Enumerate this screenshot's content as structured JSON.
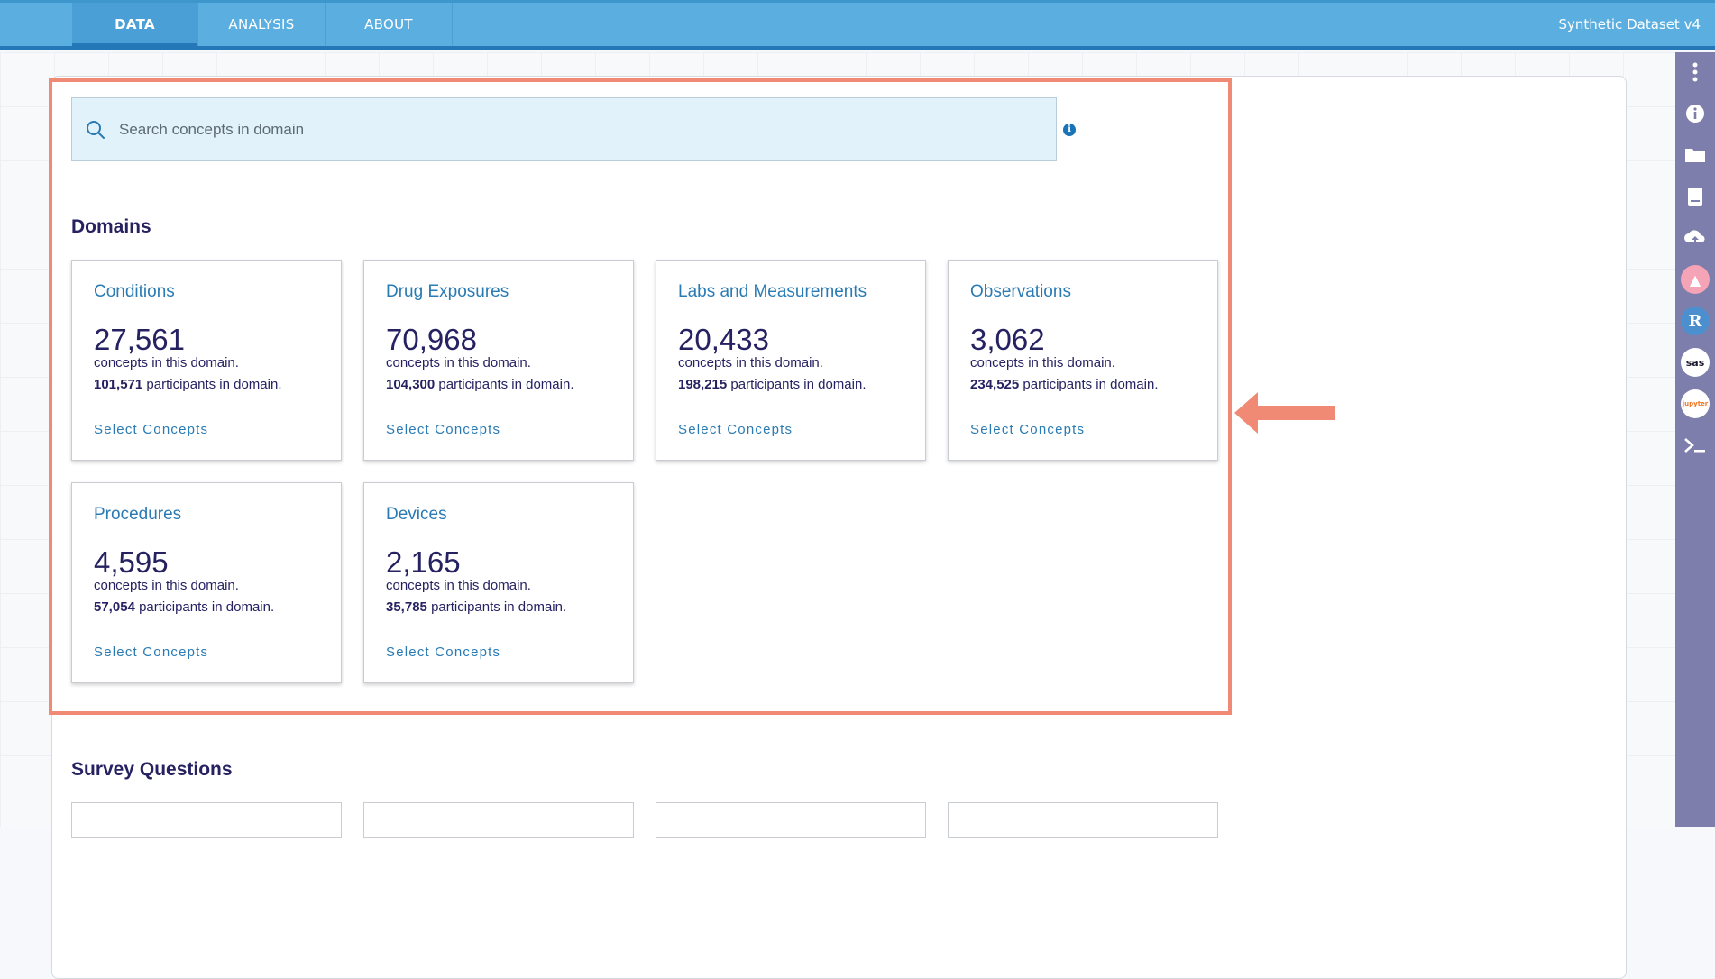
{
  "topbar": {
    "tabs": [
      {
        "label": "DATA"
      },
      {
        "label": "ANALYSIS"
      },
      {
        "label": "ABOUT"
      }
    ],
    "dataset_name": "Synthetic Dataset v4"
  },
  "search": {
    "placeholder": "Search concepts in domain"
  },
  "domains": {
    "title": "Domains",
    "select_label": "Select Concepts",
    "concepts_suffix": "concepts in this domain.",
    "participants_suffix": "participants in domain.",
    "cards": [
      {
        "name": "Conditions",
        "concept_count": "27,561",
        "participant_count": "101,571"
      },
      {
        "name": "Drug Exposures",
        "concept_count": "70,968",
        "participant_count": "104,300"
      },
      {
        "name": "Labs and Measurements",
        "concept_count": "20,433",
        "participant_count": "198,215"
      },
      {
        "name": "Observations",
        "concept_count": "3,062",
        "participant_count": "234,525"
      },
      {
        "name": "Procedures",
        "concept_count": "4,595",
        "participant_count": "57,054"
      },
      {
        "name": "Devices",
        "concept_count": "2,165",
        "participant_count": "35,785"
      }
    ]
  },
  "survey": {
    "title": "Survey Questions"
  },
  "sidebar": {
    "items": [
      {
        "icon": "more-vertical-icon"
      },
      {
        "icon": "info-icon"
      },
      {
        "icon": "folder-icon"
      },
      {
        "icon": "book-icon"
      },
      {
        "icon": "cloud-upload-icon"
      },
      {
        "icon": "cromwell-icon"
      },
      {
        "icon": "rstudio-icon",
        "text": "R"
      },
      {
        "icon": "sas-icon",
        "text": "sas"
      },
      {
        "icon": "jupyter-icon",
        "text": "jupyter"
      },
      {
        "icon": "terminal-icon"
      }
    ]
  },
  "colors": {
    "topbar": "#5aaee0",
    "accent": "#2a7bb4",
    "heading": "#262262",
    "highlight": "#f08a74",
    "sidebar": "#7d7eab"
  }
}
